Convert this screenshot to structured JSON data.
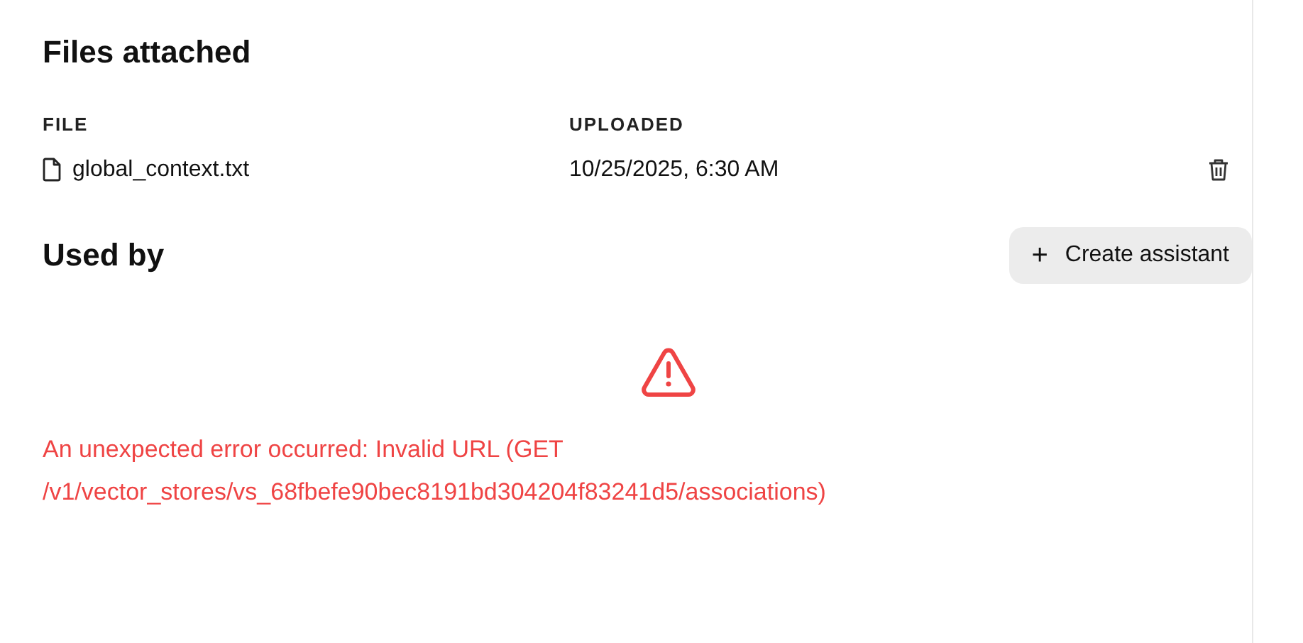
{
  "files_section": {
    "title": "Files attached",
    "columns": [
      "FILE",
      "UPLOADED"
    ],
    "rows": [
      {
        "file": "global_context.txt",
        "uploaded": "10/25/2025, 6:30 AM"
      }
    ]
  },
  "used_by": {
    "title": "Used by",
    "button": "Create assistant",
    "button_icon": "+",
    "error": "An unexpected error occurred: Invalid URL (GET /v1/vector_stores/vs_68fbefe90bec8191bd304204f83241d5/associations)"
  }
}
